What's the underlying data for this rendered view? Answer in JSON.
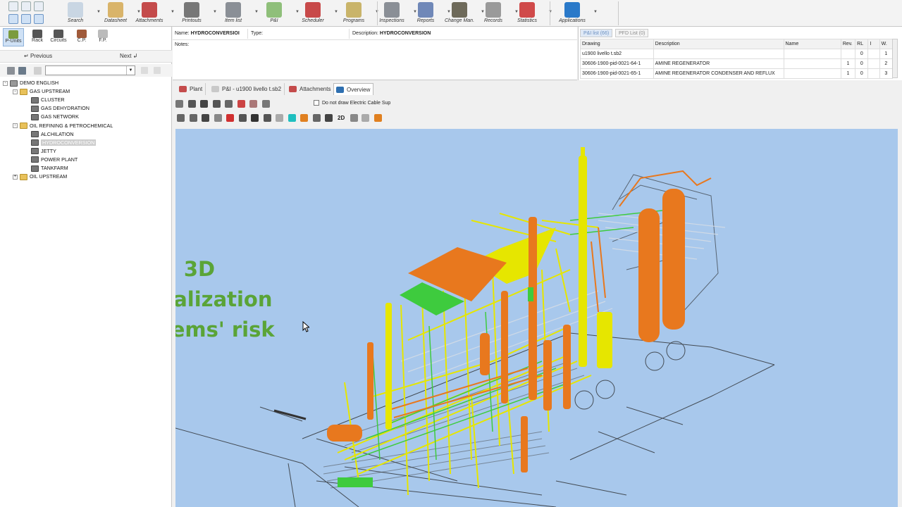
{
  "ribbon": {
    "items": [
      {
        "label": "Search",
        "icon": "magnifier-icon",
        "color": "#c9d6e3"
      },
      {
        "label": "Datasheet",
        "icon": "folder-icon",
        "color": "#d9b46a"
      },
      {
        "label": "Attachments",
        "icon": "attachment-icon",
        "color": "#c44b4b"
      },
      {
        "label": "Printouts",
        "icon": "printer-icon",
        "color": "#777777"
      },
      {
        "label": "Item list",
        "icon": "list-icon",
        "color": "#8a8f96"
      },
      {
        "label": "P&I",
        "icon": "pid-icon",
        "color": "#8fbf7a"
      },
      {
        "label": "Scheduler",
        "icon": "calendar-icon",
        "color": "#c84a4a"
      },
      {
        "label": "Programs",
        "icon": "chart-icon",
        "color": "#c9b46a"
      },
      {
        "label": "Inspections",
        "icon": "wrench-icon",
        "color": "#8a8f96"
      },
      {
        "label": "Reports",
        "icon": "reports-icon",
        "color": "#7088b8"
      },
      {
        "label": "Change Man.",
        "icon": "book-icon",
        "color": "#6e6a5a"
      },
      {
        "label": "Records",
        "icon": "records-icon",
        "color": "#9a9a9a"
      },
      {
        "label": "Statistics",
        "icon": "statistics-icon",
        "color": "#d04a4a"
      },
      {
        "label": "Applications",
        "icon": "gear-icon",
        "color": "#2a79c9"
      }
    ]
  },
  "left_tools": [
    {
      "label": "P-Units",
      "icon": "p-units-icon"
    },
    {
      "label": "Rack",
      "icon": "rack-icon"
    },
    {
      "label": "Circuits",
      "icon": "circuits-icon"
    },
    {
      "label": "C.P.",
      "icon": "pencil-icon"
    },
    {
      "label": "F.P.",
      "icon": "fp-icon"
    }
  ],
  "nav": {
    "previous": "Previous",
    "next": "Next"
  },
  "tree": [
    {
      "label": "DEMO ENGLISH",
      "level": 0,
      "type": "root",
      "exp": "-"
    },
    {
      "label": "GAS UPSTREAM",
      "level": 1,
      "type": "folder",
      "exp": "-"
    },
    {
      "label": "CLUSTER",
      "level": 2,
      "type": "unit"
    },
    {
      "label": "GAS DEHYDRATION",
      "level": 2,
      "type": "unit"
    },
    {
      "label": "GAS NETWORK",
      "level": 2,
      "type": "unit"
    },
    {
      "label": "OIL REFINING & PETROCHEMICAL",
      "level": 1,
      "type": "folder",
      "exp": "-"
    },
    {
      "label": "ALCHILATION",
      "level": 2,
      "type": "unit"
    },
    {
      "label": "HYDROCONVERSION",
      "level": 2,
      "type": "unit",
      "selected": true
    },
    {
      "label": "JETTY",
      "level": 2,
      "type": "unit"
    },
    {
      "label": "POWER PLANT",
      "level": 2,
      "type": "unit"
    },
    {
      "label": "TANKFARM",
      "level": 2,
      "type": "unit"
    },
    {
      "label": "OIL UPSTREAM",
      "level": 1,
      "type": "folder",
      "exp": "+"
    }
  ],
  "props": {
    "name_label": "Name:",
    "name_value": "HYDROCONVERSIOI",
    "type_label": "Type:",
    "desc_label": "Description:",
    "desc_value": "HYDROCONVERSION",
    "notes_label": "Notes:"
  },
  "pid": {
    "tabs": [
      {
        "label": "P&I list (66)",
        "active": true
      },
      {
        "label": "PFD List (0)",
        "active": false
      }
    ],
    "columns": [
      "Drawing",
      "Description",
      "Name",
      "Rev.",
      "RL",
      "I",
      "W."
    ],
    "rows": [
      [
        "u1900 livello t.sb2",
        "",
        "",
        "",
        "0",
        "",
        "1"
      ],
      [
        "30606-1900-pid-0021-64-1",
        "AMINE REGENERATOR",
        "",
        "1",
        "0",
        "",
        "2"
      ],
      [
        "30606-1900-pid-0021-65-1",
        "AMINE REGENERATOR CONDENSER AND REFLUX",
        "",
        "1",
        "0",
        "",
        "3"
      ]
    ]
  },
  "view_tabs": [
    {
      "label": "Plant",
      "icon": "plant-icon",
      "color": "#c44b4b"
    },
    {
      "label": "P&I - u1900 livello t.sb2",
      "icon": "pid-doc-icon",
      "color": "#c9c9c9"
    },
    {
      "label": "Attachments",
      "icon": "attachment-icon",
      "color": "#c44b4b"
    },
    {
      "label": "Overview",
      "icon": "globe-icon",
      "color": "#2e6fb0",
      "active": true
    }
  ],
  "toolbar": {
    "checkbox_label": "Do not draw Electric Cable Sup",
    "two_d": "2D"
  },
  "overlay_text": [
    "3D",
    "visualization",
    "of items' risk"
  ],
  "colors": {
    "sky": "#a8c8ec",
    "risk_high": "#e8781e",
    "risk_medium": "#e6e600",
    "risk_low": "#3ecb3e",
    "overlay": "#5aa437"
  }
}
